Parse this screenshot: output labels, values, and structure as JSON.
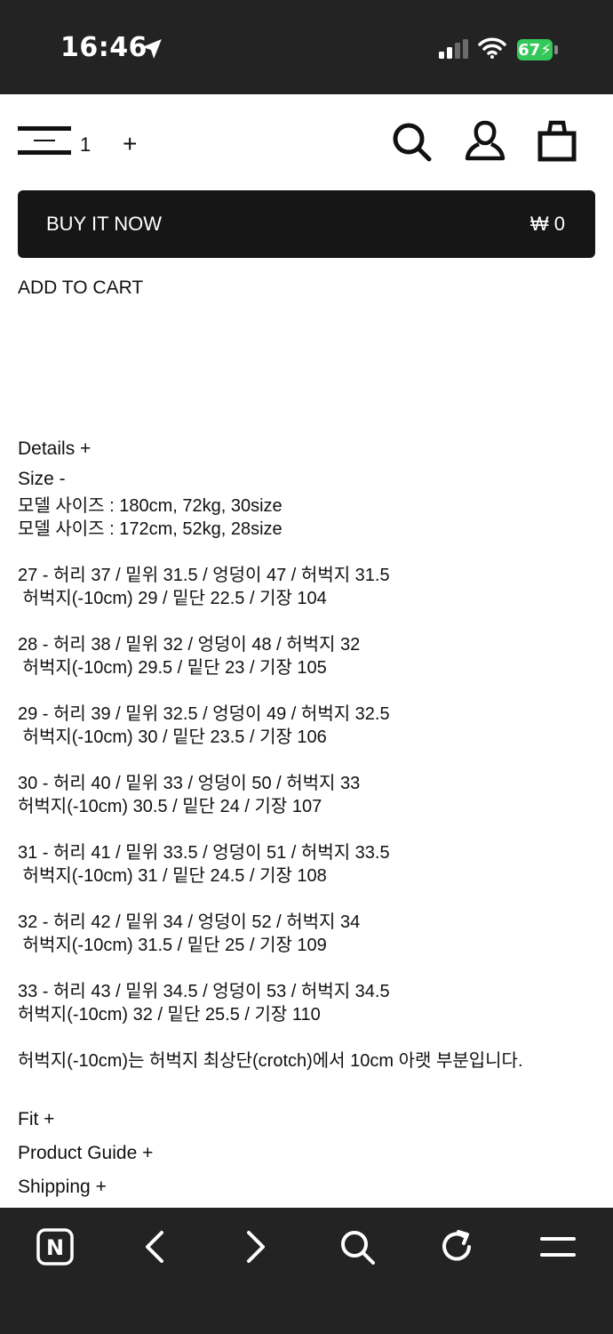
{
  "status_bar": {
    "time": "16:46",
    "battery": "67"
  },
  "header": {
    "quantity": "1",
    "plus": "+"
  },
  "buy": {
    "label": "BUY IT NOW",
    "price": "₩ 0"
  },
  "add_to_cart": "ADD TO CART",
  "details": {
    "title": "Details +"
  },
  "size": {
    "title": "Size -",
    "model_lines": [
      "모델 사이즈 : 180cm, 72kg, 30size",
      "모델 사이즈 : 172cm, 52kg, 28size"
    ],
    "entries": [
      [
        "27 - 허리 37 / 밑위 31.5 / 엉덩이 47 / 허벅지 31.5",
        " 허벅지(-10cm) 29 / 밑단 22.5 / 기장 104"
      ],
      [
        "28 - 허리 38 / 밑위 32 / 엉덩이 48 / 허벅지 32",
        " 허벅지(-10cm) 29.5 / 밑단 23 / 기장 105"
      ],
      [
        "29 - 허리 39 / 밑위 32.5 / 엉덩이 49 / 허벅지 32.5",
        " 허벅지(-10cm) 30 / 밑단 23.5 / 기장 106"
      ],
      [
        "30 - 허리 40 / 밑위 33 / 엉덩이 50 / 허벅지 33",
        "허벅지(-10cm) 30.5 / 밑단 24 / 기장 107"
      ],
      [
        "31 - 허리 41 / 밑위 33.5 / 엉덩이 51 / 허벅지 33.5",
        " 허벅지(-10cm) 31 / 밑단 24.5 / 기장 108"
      ],
      [
        "32 - 허리 42 / 밑위 34 / 엉덩이 52 / 허벅지 34",
        " 허벅지(-10cm) 31.5 / 밑단 25 / 기장 109"
      ],
      [
        "33 - 허리 43 / 밑위 34.5 / 엉덩이 53 / 허벅지 34.5",
        "허벅지(-10cm) 32 / 밑단 25.5 / 기장 110"
      ]
    ],
    "note": "허벅지(-10cm)는 허벅지 최상단(crotch)에서 10cm 아랫 부분입니다."
  },
  "sections": {
    "fit": "Fit +",
    "guide": "Product Guide +",
    "shipping": "Shipping +"
  },
  "toolbar": {
    "icons": [
      "naver-home-icon",
      "back-arrow-icon",
      "forward-arrow-icon",
      "search-icon",
      "refresh-icon",
      "menu-icon"
    ],
    "home_letter": "N"
  },
  "colors": {
    "dark": "#232323",
    "button": "#161616",
    "battery": "#34c759"
  }
}
